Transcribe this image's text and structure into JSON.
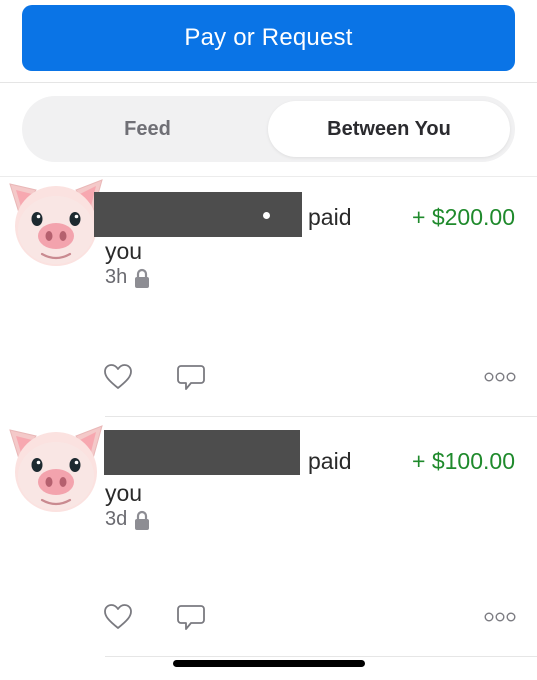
{
  "header": {
    "pay_button_label": "Pay or Request"
  },
  "tabs": {
    "feed": "Feed",
    "between_you": "Between You",
    "selected": "Between You"
  },
  "stories": [
    {
      "action": "paid",
      "target": "you",
      "amount": "+ $200.00",
      "time": "3h"
    },
    {
      "action": "paid",
      "target": "you",
      "amount": "+ $100.00",
      "time": "3d"
    }
  ],
  "colors": {
    "accent_blue": "#0a74e6",
    "amount_green": "#1f8a2c",
    "redaction": "#4d4d4d"
  },
  "icons": {
    "avatar": "pig-avatar-icon",
    "privacy": "lock-icon",
    "like": "heart-icon",
    "comment": "comment-icon",
    "more": "more-options-icon"
  }
}
